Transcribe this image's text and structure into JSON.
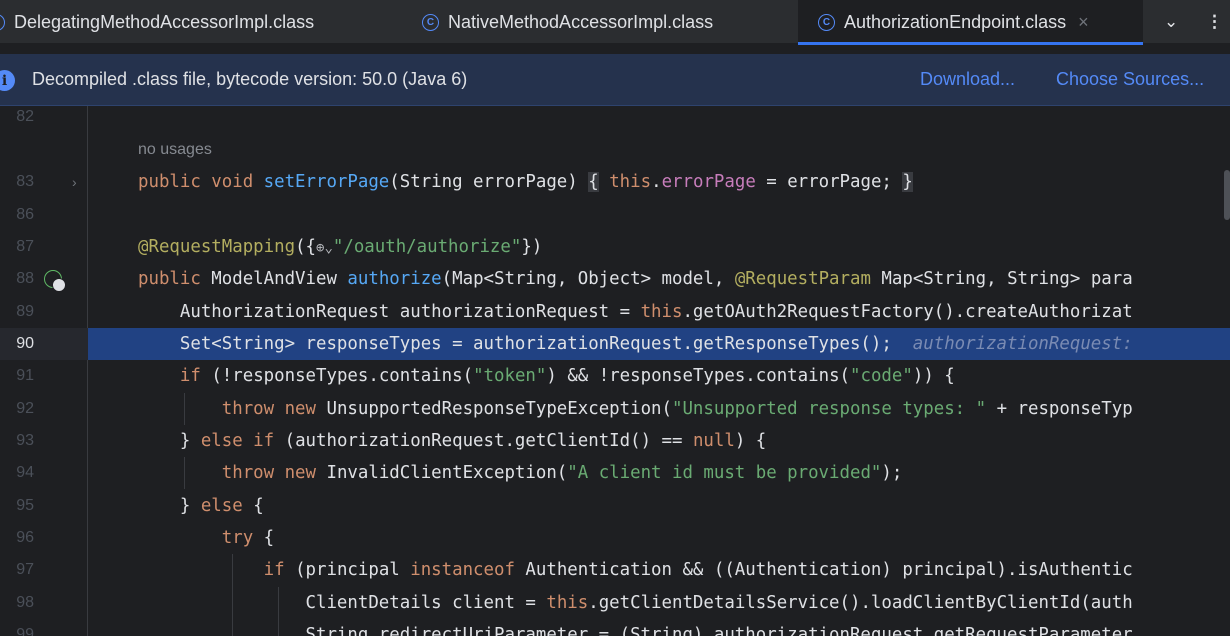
{
  "tabs": [
    {
      "icon": "class-icon",
      "label": "DelegatingMethodAccessorImpl.class"
    },
    {
      "icon": "class-icon",
      "label": "NativeMethodAccessorImpl.class"
    },
    {
      "icon": "class-icon",
      "label": "AuthorizationEndpoint.class",
      "active": true
    }
  ],
  "tab_icon_glyph": "C",
  "tab_close": "×",
  "tabs_menu": {
    "chevron": "⌄",
    "more": "⋮"
  },
  "banner": {
    "icon": "i",
    "text": "Decompiled .class file, bytecode version: 50.0 (Java 6)",
    "download": "Download...",
    "choose_sources": "Choose Sources..."
  },
  "editor": {
    "usage_hint": "no usages",
    "lines": [
      {
        "n": "82",
        "tokens": []
      },
      {
        "n": "83",
        "tokens": [
          {
            "t": "public void ",
            "c": "kw"
          },
          {
            "t": "setErrorPage",
            "c": "fn"
          },
          {
            "t": "(String errorPage) "
          },
          {
            "t": "{",
            "c": "box"
          },
          {
            "t": " "
          },
          {
            "t": "this",
            "c": "kw"
          },
          {
            "t": "."
          },
          {
            "t": "errorPage",
            "c": "fld"
          },
          {
            "t": " = errorPage; "
          },
          {
            "t": "}",
            "c": "box"
          }
        ]
      },
      {
        "n": "86",
        "tokens": []
      },
      {
        "n": "87",
        "tokens": [
          {
            "t": "@RequestMapping",
            "c": "ann"
          },
          {
            "t": "({"
          },
          {
            "t": "⊕⌄",
            "c": "globe"
          },
          {
            "t": "\"/oauth/authorize\"",
            "c": "str"
          },
          {
            "t": "})"
          }
        ]
      },
      {
        "n": "88",
        "tokens": [
          {
            "t": "public ",
            "c": "kw"
          },
          {
            "t": "ModelAndView "
          },
          {
            "t": "authorize",
            "c": "fn"
          },
          {
            "t": "(Map<String, Object> model, "
          },
          {
            "t": "@RequestParam",
            "c": "ann"
          },
          {
            "t": " Map<String, String> para"
          }
        ]
      },
      {
        "n": "89",
        "tokens": [
          {
            "t": "    AuthorizationRequest authorizationRequest = "
          },
          {
            "t": "this",
            "c": "kw"
          },
          {
            "t": ".getOAuth2RequestFactory().createAuthorizat"
          }
        ]
      },
      {
        "n": "90",
        "tokens": [
          {
            "t": "    Set<String> responseTypes = authorizationRequest.getResponseTypes();  "
          },
          {
            "t": "authorizationRequest:",
            "c": "inlay"
          }
        ]
      },
      {
        "n": "91",
        "tokens": [
          {
            "t": "    "
          },
          {
            "t": "if",
            "c": "kw"
          },
          {
            "t": " (!responseTypes.contains("
          },
          {
            "t": "\"token\"",
            "c": "str"
          },
          {
            "t": ") && !responseTypes.contains("
          },
          {
            "t": "\"code\"",
            "c": "str"
          },
          {
            "t": ")) {"
          }
        ]
      },
      {
        "n": "92",
        "tokens": [
          {
            "t": "        "
          },
          {
            "t": "throw new ",
            "c": "kw"
          },
          {
            "t": "UnsupportedResponseTypeException("
          },
          {
            "t": "\"Unsupported response types: \"",
            "c": "str"
          },
          {
            "t": " + responseTyp"
          }
        ]
      },
      {
        "n": "93",
        "tokens": [
          {
            "t": "    } "
          },
          {
            "t": "else if",
            "c": "kw"
          },
          {
            "t": " (authorizationRequest.getClientId() == "
          },
          {
            "t": "null",
            "c": "kw"
          },
          {
            "t": ") {"
          }
        ]
      },
      {
        "n": "94",
        "tokens": [
          {
            "t": "        "
          },
          {
            "t": "throw new ",
            "c": "kw"
          },
          {
            "t": "InvalidClientException("
          },
          {
            "t": "\"A client id must be provided\"",
            "c": "str"
          },
          {
            "t": ");"
          }
        ]
      },
      {
        "n": "95",
        "tokens": [
          {
            "t": "    } "
          },
          {
            "t": "else",
            "c": "kw"
          },
          {
            "t": " {"
          }
        ]
      },
      {
        "n": "96",
        "tokens": [
          {
            "t": "        "
          },
          {
            "t": "try",
            "c": "kw"
          },
          {
            "t": " {"
          }
        ]
      },
      {
        "n": "97",
        "tokens": [
          {
            "t": "            "
          },
          {
            "t": "if",
            "c": "kw"
          },
          {
            "t": " (principal "
          },
          {
            "t": "instanceof",
            "c": "kw"
          },
          {
            "t": " Authentication && ((Authentication) principal).isAuthentic"
          }
        ]
      },
      {
        "n": "98",
        "tokens": [
          {
            "t": "                ClientDetails client = "
          },
          {
            "t": "this",
            "c": "kw"
          },
          {
            "t": ".getClientDetailsService().loadClientByClientId(auth"
          }
        ]
      },
      {
        "n": "99",
        "tokens": [
          {
            "t": "                String redirectUriParameter = (String) authorizationRequest.getRequestParameter"
          }
        ]
      }
    ]
  }
}
